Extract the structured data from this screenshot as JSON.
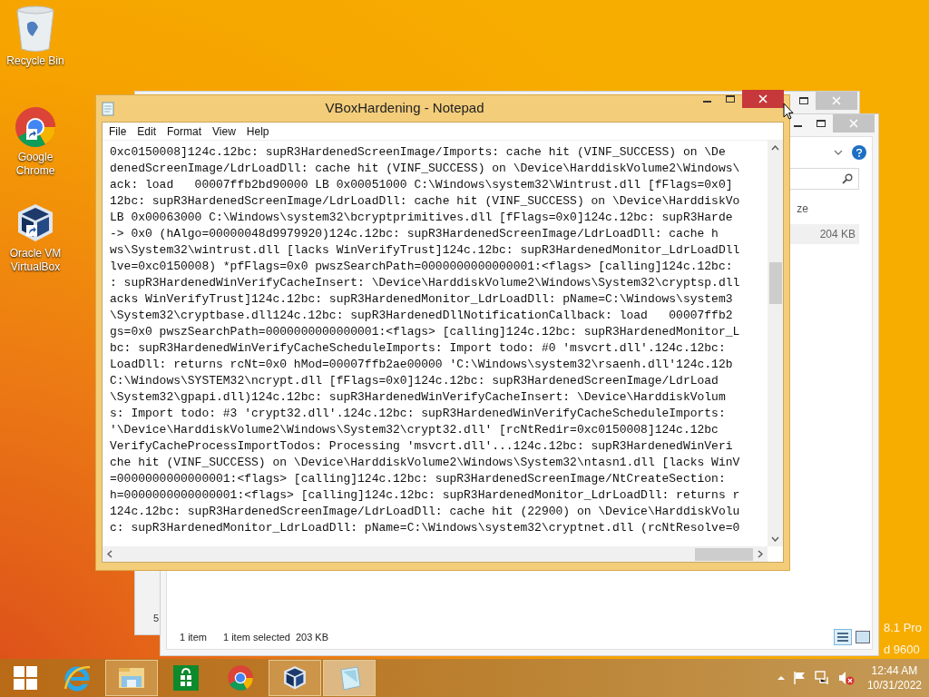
{
  "desktop_icons": [
    {
      "label": "Recycle Bin",
      "kind": "recycle"
    },
    {
      "label": "Google Chrome",
      "kind": "chrome"
    },
    {
      "label": "Oracle VM VirtualBox",
      "kind": "virtualbox"
    }
  ],
  "os_build_text": [
    "8.1 Pro",
    "d 9600"
  ],
  "explorer_back": {
    "fragment": "5"
  },
  "explorer": {
    "column_header": "ze",
    "size_cell": "204 KB",
    "status_count": "1 item",
    "status_selected": "1 item selected",
    "status_size": "203 KB"
  },
  "notepad": {
    "title": "VBoxHardening - Notepad",
    "menu": [
      "File",
      "Edit",
      "Format",
      "View",
      "Help"
    ],
    "lines": [
      "0xc0150008]124c.12bc: supR3HardenedScreenImage/Imports: cache hit (VINF_SUCCESS) on \\De",
      "denedScreenImage/LdrLoadDll: cache hit (VINF_SUCCESS) on \\Device\\HarddiskVolume2\\Windows\\",
      "ack: load   00007ffb2bd90000 LB 0x00051000 C:\\Windows\\system32\\Wintrust.dll [fFlags=0x0]",
      "12bc: supR3HardenedScreenImage/LdrLoadDll: cache hit (VINF_SUCCESS) on \\Device\\HarddiskVo",
      "LB 0x00063000 C:\\Windows\\system32\\bcryptprimitives.dll [fFlags=0x0]124c.12bc: supR3Harde",
      "-> 0x0 (hAlgo=00000048d9979920)124c.12bc: supR3HardenedScreenImage/LdrLoadDll: cache h",
      "ws\\System32\\wintrust.dll [lacks WinVerifyTrust]124c.12bc: supR3HardenedMonitor_LdrLoadDll",
      "lve=0xc0150008) *pfFlags=0x0 pwszSearchPath=0000000000000001:<flags> [calling]124c.12bc:",
      ": supR3HardenedWinVerifyCacheInsert: \\Device\\HarddiskVolume2\\Windows\\System32\\cryptsp.dll",
      "acks WinVerifyTrust]124c.12bc: supR3HardenedMonitor_LdrLoadDll: pName=C:\\Windows\\system3",
      "\\System32\\cryptbase.dll124c.12bc: supR3HardenedDllNotificationCallback: load   00007ffb2",
      "gs=0x0 pwszSearchPath=0000000000000001:<flags> [calling]124c.12bc: supR3HardenedMonitor_L",
      "bc: supR3HardenedWinVerifyCacheScheduleImports: Import todo: #0 'msvcrt.dll'.124c.12bc:",
      "LoadDll: returns rcNt=0x0 hMod=00007ffb2ae00000 'C:\\Windows\\system32\\rsaenh.dll'124c.12b",
      "C:\\Windows\\SYSTEM32\\ncrypt.dll [fFlags=0x0]124c.12bc: supR3HardenedScreenImage/LdrLoad",
      "\\System32\\gpapi.dll)124c.12bc: supR3HardenedWinVerifyCacheInsert: \\Device\\HarddiskVolum",
      "s: Import todo: #3 'crypt32.dll'.124c.12bc: supR3HardenedWinVerifyCacheScheduleImports:",
      "'\\Device\\HarddiskVolume2\\Windows\\System32\\crypt32.dll' [rcNtRedir=0xc0150008]124c.12bc",
      "VerifyCacheProcessImportTodos: Processing 'msvcrt.dll'...124c.12bc: supR3HardenedWinVeri",
      "che hit (VINF_SUCCESS) on \\Device\\HarddiskVolume2\\Windows\\System32\\ntasn1.dll [lacks WinV",
      "=0000000000000001:<flags> [calling]124c.12bc: supR3HardenedScreenImage/NtCreateSection:",
      "h=0000000000000001:<flags> [calling]124c.12bc: supR3HardenedMonitor_LdrLoadDll: returns r",
      "124c.12bc: supR3HardenedScreenImage/LdrLoadDll: cache hit (22900) on \\Device\\HarddiskVolu",
      "c: supR3HardenedMonitor_LdrLoadDll: pName=C:\\Windows\\system32\\cryptnet.dll (rcNtResolve=0"
    ]
  },
  "taskbar": {
    "apps": [
      {
        "kind": "ie",
        "running": false,
        "active": false
      },
      {
        "kind": "explorer",
        "running": true,
        "active": false
      },
      {
        "kind": "store",
        "running": false,
        "active": false
      },
      {
        "kind": "chrome",
        "running": false,
        "active": false
      },
      {
        "kind": "virtualbox",
        "running": true,
        "active": false
      },
      {
        "kind": "notepad",
        "running": true,
        "active": true
      }
    ],
    "tray_muted": true,
    "time": "12:44 AM",
    "date": "10/31/2022"
  }
}
